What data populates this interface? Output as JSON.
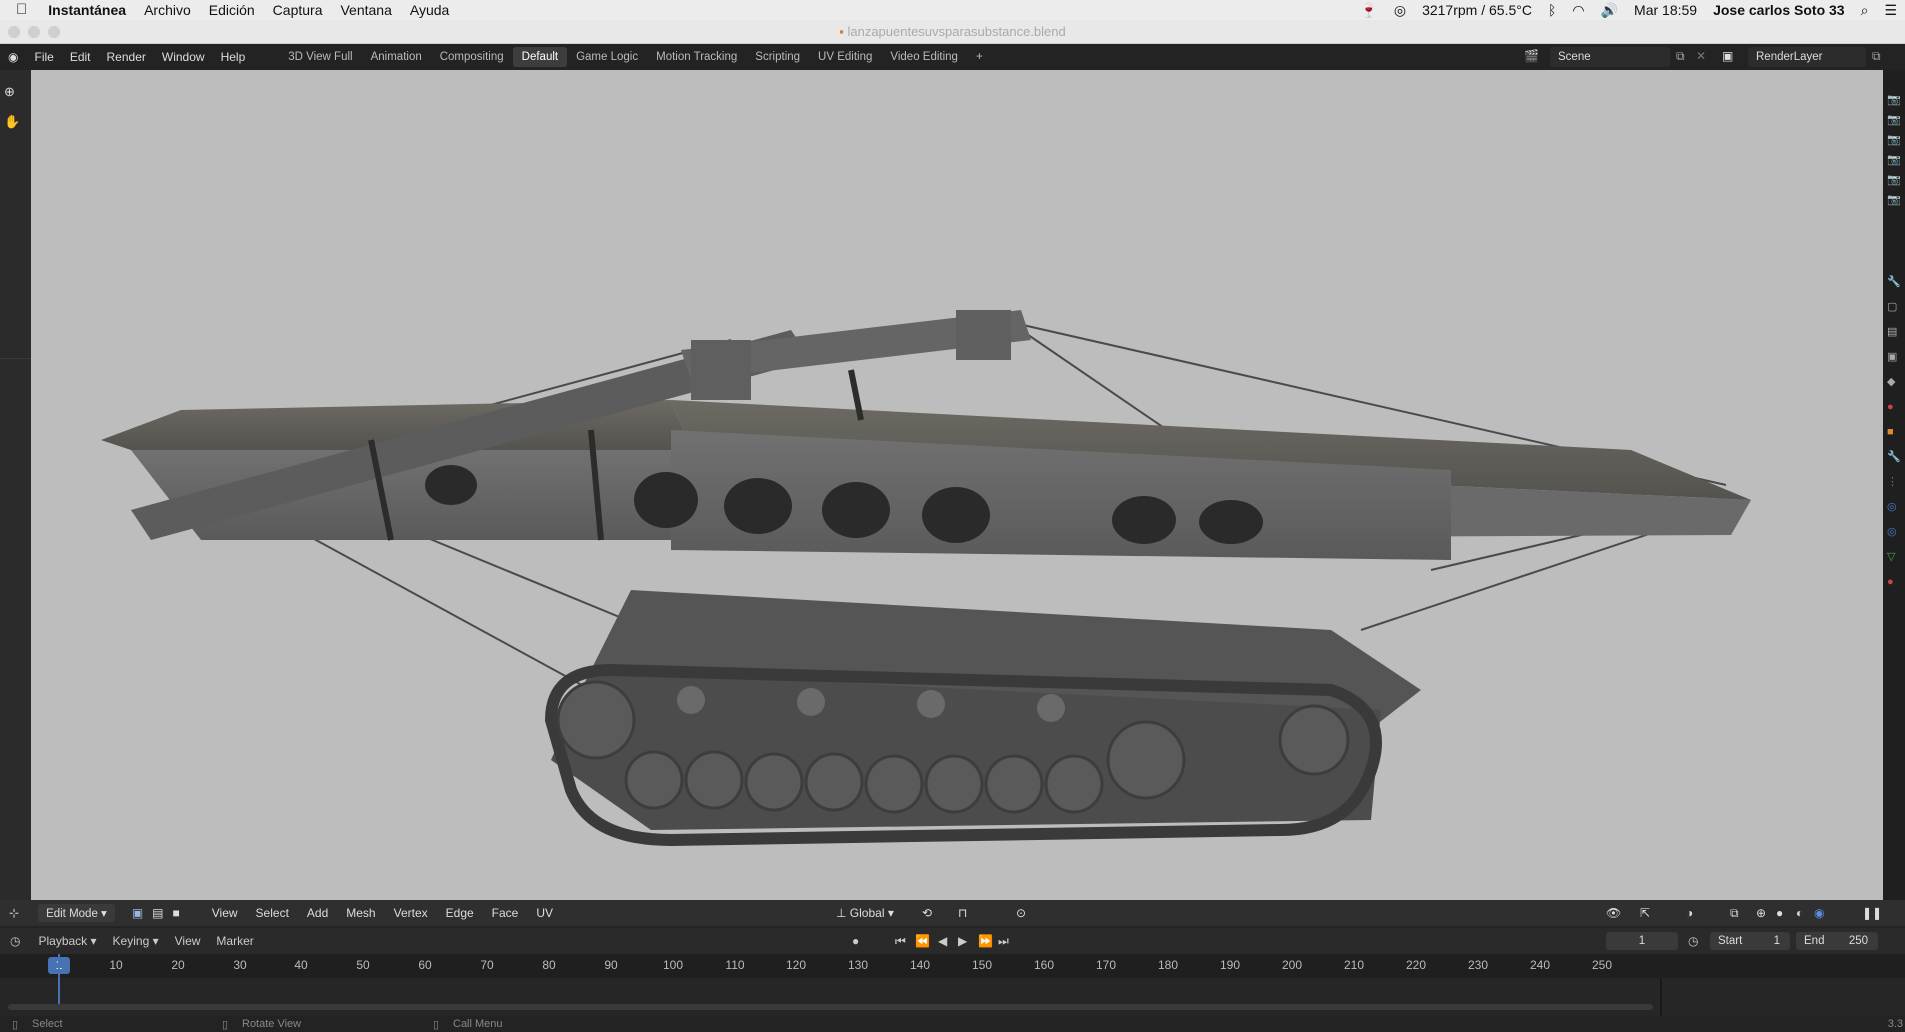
{
  "mac": {
    "app_name": "Instantánea",
    "menus": [
      "Archivo",
      "Edición",
      "Captura",
      "Ventana",
      "Ayuda"
    ],
    "status": "3217rpm / 65.5°C",
    "clock": "Mar 18:59",
    "user": "Jose carlos Soto 33"
  },
  "window": {
    "title": "lanzapuentesuvsparasubstance.blend"
  },
  "blender": {
    "menus": [
      "File",
      "Edit",
      "Render",
      "Window",
      "Help"
    ],
    "workspaces": [
      "3D View Full",
      "Animation",
      "Compositing",
      "Default",
      "Game Logic",
      "Motion Tracking",
      "Scripting",
      "UV Editing",
      "Video Editing"
    ],
    "active_workspace": "Default",
    "scene": "Scene",
    "render_layer": "RenderLayer"
  },
  "view_header": {
    "mode": "Edit Mode",
    "menus": [
      "View",
      "Select",
      "Add",
      "Mesh",
      "Vertex",
      "Edge",
      "Face",
      "UV"
    ],
    "orientation": "Global"
  },
  "timeline": {
    "menus": [
      "Playback",
      "Keying",
      "View",
      "Marker"
    ],
    "current_frame": "1",
    "start_label": "Start",
    "start": "1",
    "end_label": "End",
    "end": "250",
    "ticks": [
      "10",
      "20",
      "30",
      "40",
      "50",
      "60",
      "70",
      "80",
      "90",
      "100",
      "110",
      "120",
      "130",
      "140",
      "150",
      "160",
      "170",
      "180",
      "190",
      "200",
      "210",
      "220",
      "230",
      "240",
      "250"
    ]
  },
  "statusbar": {
    "select": "Select",
    "rotate": "Rotate View",
    "menu": "Call Menu",
    "version": "3.3"
  },
  "colors": {
    "viewport_bg": "#bdbdbd",
    "accent": "#4772b3"
  }
}
